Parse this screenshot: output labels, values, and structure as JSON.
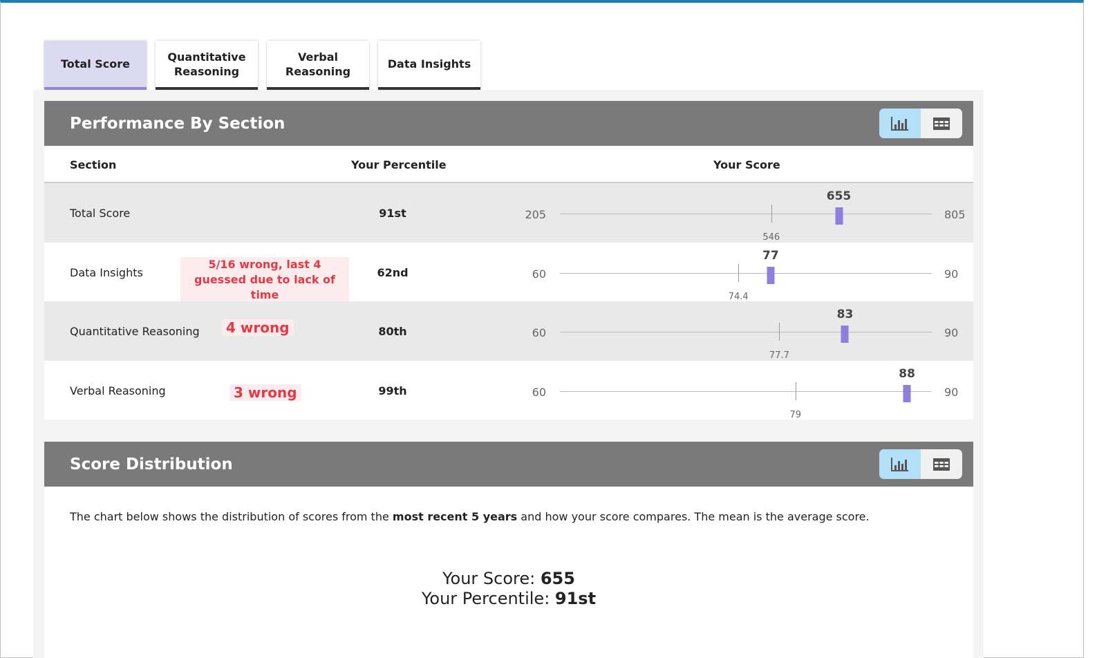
{
  "tabs": [
    "Total Score",
    "Quantitative Reasoning",
    "Verbal Reasoning",
    "Data Insights"
  ],
  "performance": {
    "title": "Performance By Section",
    "columns": {
      "section": "Section",
      "percentile": "Your Percentile",
      "score": "Your Score"
    },
    "rows": [
      {
        "section": "Total Score",
        "note": "",
        "percentile": "91st",
        "min": 205,
        "max": 805,
        "mean": 546,
        "score": 655
      },
      {
        "section": "Data Insights",
        "note": "5/16 wrong, last 4 guessed due to lack of time",
        "percentile": "62nd",
        "min": 60,
        "max": 90,
        "mean": 74.4,
        "score": 77
      },
      {
        "section": "Quantitative Reasoning",
        "note": "4 wrong",
        "percentile": "80th",
        "min": 60,
        "max": 90,
        "mean": 77.7,
        "score": 83
      },
      {
        "section": "Verbal Reasoning",
        "note": "3 wrong",
        "percentile": "99th",
        "min": 60,
        "max": 90,
        "mean": 79,
        "score": 88
      }
    ]
  },
  "distribution": {
    "title": "Score Distribution",
    "desc_1": "The chart below shows the distribution of scores from the ",
    "desc_bold": "most recent 5 years",
    "desc_2": " and how your score compares. The mean is the average score.",
    "score_label": "Your Score: ",
    "score_value": "655",
    "percentile_label": "Your Percentile: ",
    "percentile_value": "91st"
  },
  "colors": {
    "accent": "#8d7fdc",
    "note": "#e63946",
    "header": "#7a7a7a",
    "toggle_active": "#b3e0f6"
  }
}
